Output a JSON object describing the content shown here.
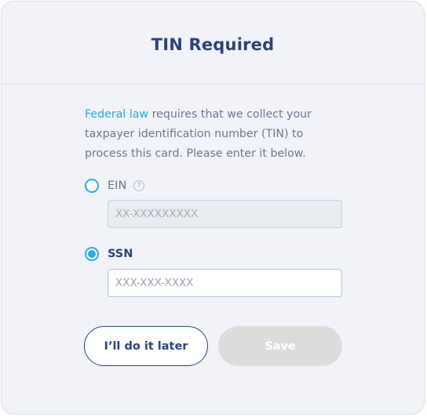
{
  "dialog": {
    "title": "TIN Required",
    "description": {
      "link_text": "Federal law",
      "text": " requires that we collect your taxpayer identification number (TIN) to process this card. Please enter it below."
    },
    "options": {
      "ein": {
        "label": "EIN",
        "help_glyph": "?",
        "selected": false,
        "placeholder": "XX-XXXXXXXXX",
        "value": ""
      },
      "ssn": {
        "label": "SSN",
        "selected": true,
        "placeholder": "XXX-XXX-XXXX",
        "value": ""
      }
    },
    "buttons": {
      "later": "I’ll do it later",
      "save": "Save"
    }
  },
  "colors": {
    "title": "#2c4473",
    "link": "#24a9d9",
    "radio_accent": "#31a9e1",
    "primary_outline": "#2c4473",
    "disabled_button": "#dcdcdd",
    "background": "#f1f3f9"
  },
  "icons": {
    "ein_help": "help-circle-icon"
  }
}
